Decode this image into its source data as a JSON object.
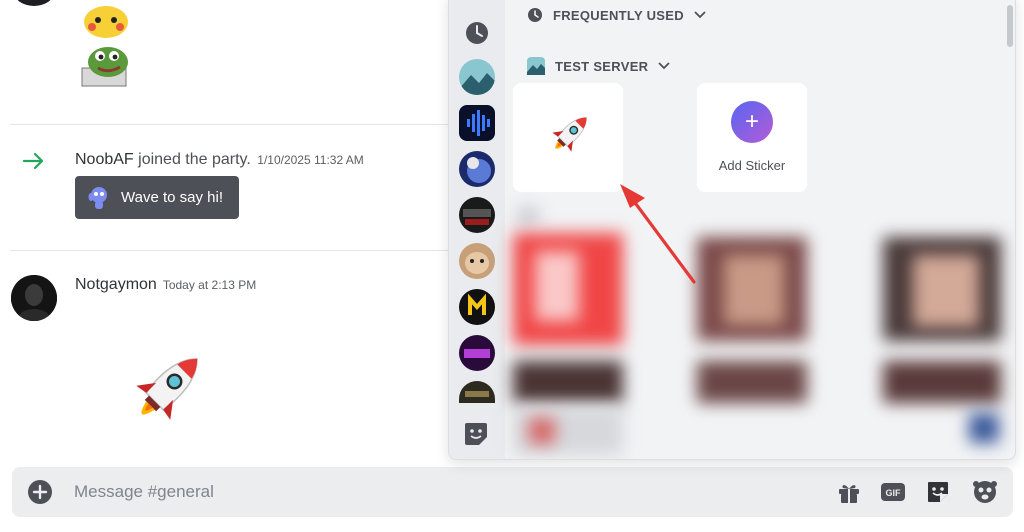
{
  "chat": {
    "join_name": "NoobAF",
    "join_action": " joined the party.",
    "join_time": "1/10/2025 11:32 AM",
    "wave_button": "Wave to say hi!",
    "message_author": "Notgaymon",
    "message_time": "Today at 2:13 PM"
  },
  "composer": {
    "placeholder": "Message #general",
    "gif_label": "GIF"
  },
  "picker": {
    "frequently_used": "FREQUENTLY USED",
    "server_name": "TEST SERVER",
    "add_sticker": "Add Sticker",
    "rail_icons": [
      "recent-clock-icon",
      "server-mountain-icon",
      "server-audio-icon",
      "server-earth-icon",
      "server-call-of-duty-icon",
      "server-cat-icon",
      "server-m-logo-icon",
      "server-unite-icon",
      "server-combat-icon",
      "sticker-settings-icon"
    ]
  },
  "colors": {
    "accent": "#5865f2",
    "join_arrow": "#23a55a",
    "annotation_arrow": "#e53935"
  }
}
